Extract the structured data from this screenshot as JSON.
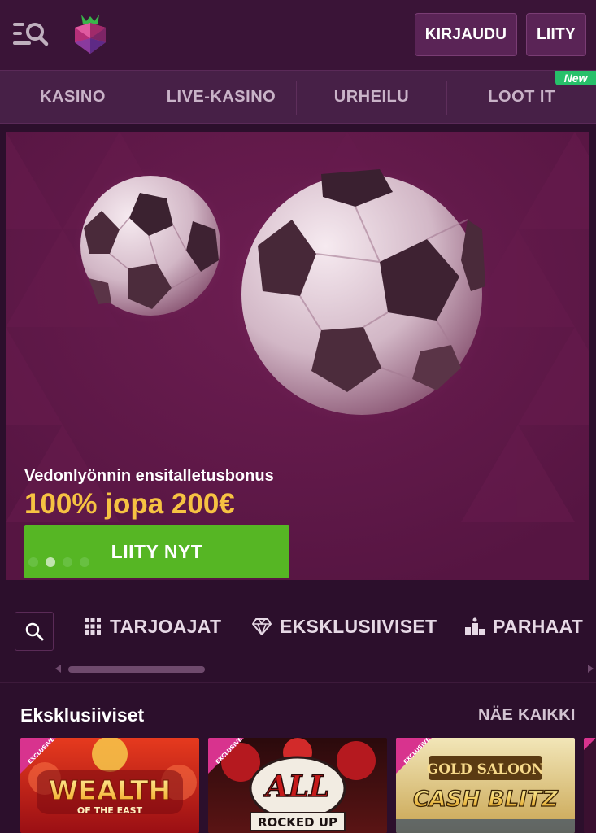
{
  "header": {
    "login_label": "KIRJAUDU",
    "join_label": "LIITY"
  },
  "nav": {
    "items": [
      {
        "label": "KASINO"
      },
      {
        "label": "LIVE-KASINO"
      },
      {
        "label": "URHEILU"
      },
      {
        "label": "LOOT IT"
      }
    ],
    "new_badge": "New"
  },
  "hero": {
    "subtitle": "Vedonlyönnin ensitalletusbonus",
    "title": "100% jopa 200€",
    "cta": "LIITY NYT",
    "slides": 4,
    "active_slide": 2
  },
  "filters": {
    "tabs": [
      {
        "label": "TARJOAJAT",
        "icon": "grid-icon"
      },
      {
        "label": "EKSKLUSIIVISET",
        "icon": "diamond-icon"
      },
      {
        "label": "PARHAAT",
        "icon": "podium-icon"
      }
    ]
  },
  "section": {
    "title": "Eksklusiiviset",
    "see_all": "NÄE KAIKKI"
  },
  "games": [
    {
      "badge": "EXCLUSIVE",
      "title_top": "WEALTH",
      "title_sub": "OF THE EAST",
      "accent": "#c6141c"
    },
    {
      "badge": "EXCLUSIVE",
      "title_top": "ALL",
      "title_sub": "ROCKED UP",
      "accent": "#6a1414"
    },
    {
      "badge": "EXCLUSIVE",
      "title_top": "GOLD SALOON",
      "title_sub": "CASH BLITZ",
      "accent": "#6b4a12"
    }
  ],
  "colors": {
    "header_bg": "#3a1437",
    "nav_bg": "#472047",
    "hero_bg": "#5e1847",
    "cta_green": "#56b624",
    "title_gold": "#f6c242",
    "badge_green": "#27c06a"
  }
}
